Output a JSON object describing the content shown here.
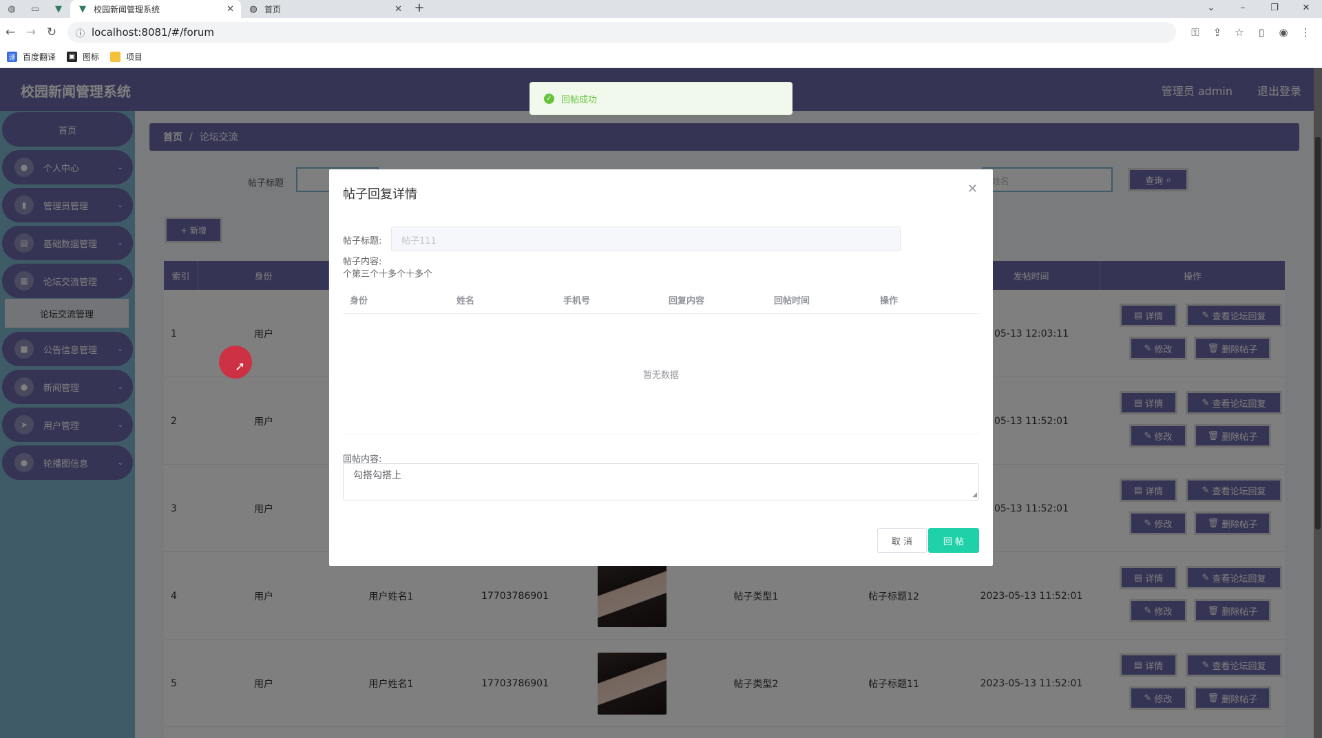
{
  "browser": {
    "tabs": [
      {
        "title": "校园新闻管理系统",
        "active": true,
        "icon": "vue-logo-icon"
      },
      {
        "title": "首页",
        "active": false,
        "icon": "globe-icon"
      }
    ],
    "url": "localhost:8081/#/forum",
    "bookmarks": [
      {
        "label": "百度翻译",
        "icon": "translate-icon",
        "color": "#3b6fe0"
      },
      {
        "label": "图标",
        "icon": "picture-icon",
        "color": "#222222"
      },
      {
        "label": "项目",
        "icon": "folder-icon",
        "color": "#f4c13a"
      }
    ]
  },
  "header": {
    "brand": "校园新闻管理系统",
    "user": "管理员 admin",
    "logout": "退出登录"
  },
  "sidebar": {
    "home": "首页",
    "items": [
      {
        "label": "个人中心",
        "icon": "user-icon"
      },
      {
        "label": "管理员管理",
        "icon": "bar-chart-icon"
      },
      {
        "label": "基础数据管理",
        "icon": "clipboard-icon"
      },
      {
        "label": "论坛交流管理",
        "icon": "grid-icon"
      },
      {
        "label": "公告信息管理",
        "icon": "video-icon"
      },
      {
        "label": "新闻管理",
        "icon": "location-icon"
      },
      {
        "label": "用户管理",
        "icon": "send-icon"
      },
      {
        "label": "轮播图信息",
        "icon": "person-icon"
      }
    ],
    "sub_item": "论坛交流管理"
  },
  "breadcrumb": {
    "home": "首页",
    "sep": "/",
    "current": "论坛交流"
  },
  "search": {
    "label": "帖子标题",
    "placeholder1": "帖",
    "placeholder2": "姓名",
    "query_btn": "查询",
    "add_btn": "+ 新增"
  },
  "table": {
    "columns": [
      "索引",
      "身份",
      "",
      "",
      "",
      "",
      "",
      "发帖时间",
      "操作"
    ],
    "rows": [
      {
        "idx": "1",
        "role": "用户",
        "name": "",
        "phone": "",
        "type": "",
        "title": "",
        "time": "05-13 12:03:11"
      },
      {
        "idx": "2",
        "role": "用户",
        "name": "",
        "phone": "",
        "type": "",
        "title": "",
        "time": "05-13 11:52:01"
      },
      {
        "idx": "3",
        "role": "用户",
        "name": "",
        "phone": "",
        "type": "",
        "title": "",
        "time": "05-13 11:52:01"
      },
      {
        "idx": "4",
        "role": "用户",
        "name": "用户姓名1",
        "phone": "17703786901",
        "type": "帖子类型1",
        "title": "帖子标题12",
        "time": "2023-05-13 11:52:01"
      },
      {
        "idx": "5",
        "role": "用户",
        "name": "用户姓名1",
        "phone": "17703786901",
        "type": "帖子类型2",
        "title": "帖子标题11",
        "time": "2023-05-13 11:52:01"
      }
    ],
    "ops": {
      "detail": "详情",
      "view_reply": "查看论坛回复",
      "edit": "修改",
      "delete": "删除帖子"
    }
  },
  "toast": {
    "message": "回帖成功"
  },
  "dialog": {
    "title": "帖子回复详情",
    "title_label": "帖子标题:",
    "title_value": "帖子111",
    "content_label": "帖子内容:",
    "content_value": "个第三个十多个十多个",
    "columns": [
      "身份",
      "姓名",
      "手机号",
      "回复内容",
      "回帖时间",
      "操作"
    ],
    "empty": "暂无数据",
    "reply_label": "回帖内容:",
    "reply_value": "勾搭勾搭上",
    "cancel": "取 消",
    "submit": "回 帖"
  },
  "colors": {
    "primary": "#6a68a8",
    "sidebar_bg": "#7fb6cf",
    "success": "#67c23a",
    "submit": "#1fd1a8"
  }
}
